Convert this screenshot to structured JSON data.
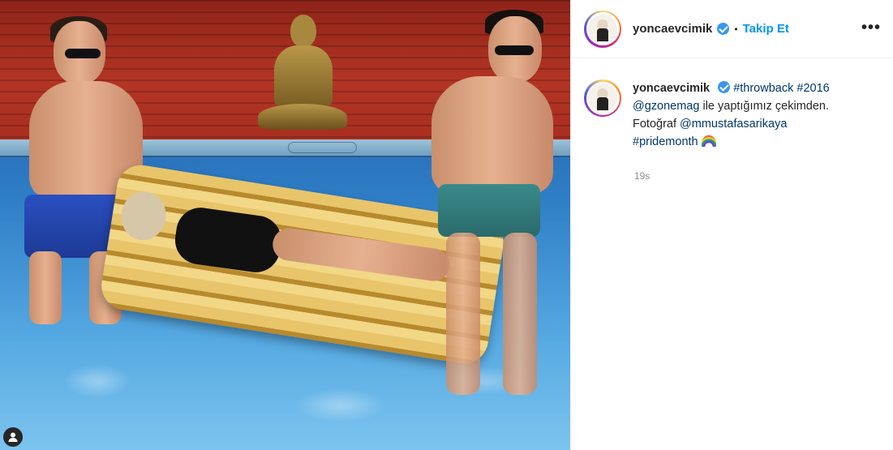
{
  "post": {
    "media": {
      "user_tag_icon": "person-icon"
    }
  },
  "header": {
    "username": "yoncaevcimik",
    "separator": "•",
    "follow_label": "Takip Et",
    "more_label": "•••"
  },
  "caption": {
    "username": "yoncaevcimik",
    "hashtag_throwback": "#throwback",
    "hashtag_year": "#2016",
    "mention_gzone": "@gzonemag",
    "text_1": " ile yaptığımız çekimden.",
    "photo_prefix": "Fotoğraf ",
    "mention_photographer": "@mmustafasarikaya",
    "hashtag_pride": "#pridemonth",
    "emoji": "rainbow-emoji"
  },
  "timestamp": "19s",
  "colors": {
    "link_blue": "#0095f6",
    "tag_blue": "#00376b",
    "verified_blue": "#3897f0",
    "muted": "#8e8e8e"
  }
}
